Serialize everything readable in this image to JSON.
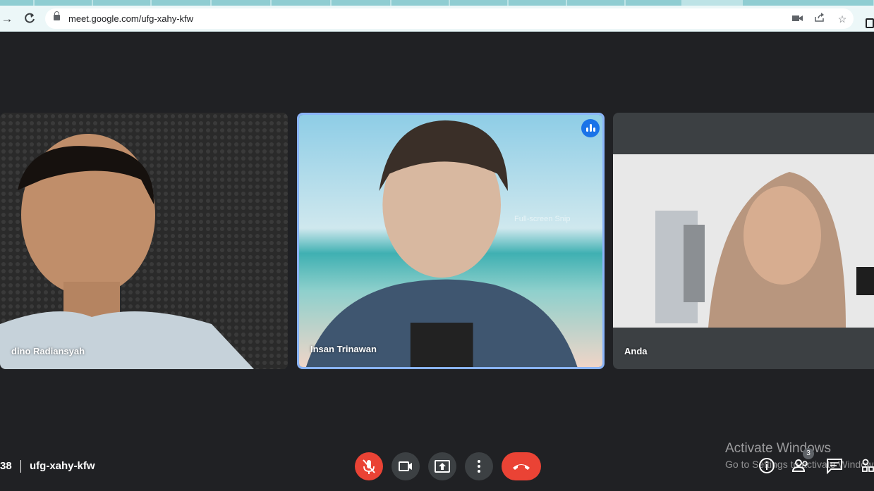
{
  "browser": {
    "url": "meet.google.com/ufg-xahy-kfw",
    "back_icon": "arrow-right-icon",
    "reload_icon": "reload-icon"
  },
  "participants": [
    {
      "name": "dino Radiansyah",
      "speaking": false
    },
    {
      "name": "Insan Trinawan",
      "speaking": true
    },
    {
      "name": "Anda",
      "speaking": false
    }
  ],
  "overlay": {
    "snip_text": "Full-screen Snip"
  },
  "meeting": {
    "time": "38",
    "code": "ufg-xahy-kfw",
    "people_count": "3"
  },
  "windows": {
    "activate_title": "Activate Windows",
    "activate_sub": "Go to Settings to activate Windows."
  },
  "colors": {
    "background": "#202124",
    "accent_blue": "#8ab4f8",
    "danger_red": "#ea4335",
    "button_gray": "#3c4043"
  }
}
